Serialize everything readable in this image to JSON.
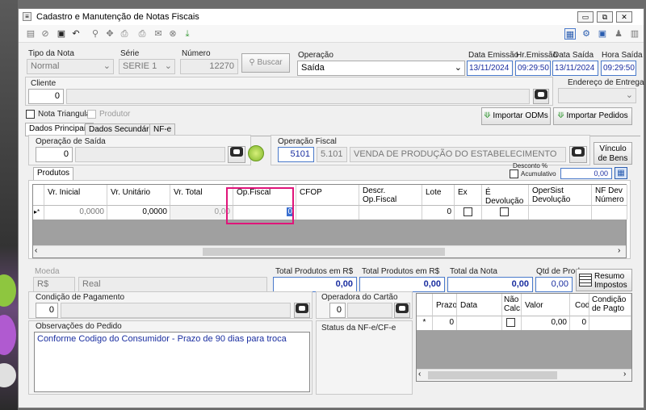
{
  "window": {
    "title": "Cadastro e Manutenção de Notas Fiscais",
    "controls": [
      "▭",
      "⧉",
      "✕"
    ]
  },
  "toolbar": {
    "left_icons": [
      "new-icon",
      "cancel-icon",
      "save-icon",
      "undo-icon",
      "search-icon",
      "tools-icon",
      "print-icon",
      "print2-icon",
      "email-icon",
      "block-icon",
      "download-icon"
    ],
    "right_icons": [
      "view-icon",
      "settings-icon",
      "window-icon",
      "user-icon",
      "config-icon"
    ]
  },
  "header": {
    "tipo_nota_label": "Tipo da Nota",
    "tipo_nota_value": "Normal",
    "serie_label": "Série",
    "serie_value": "SERIE 1",
    "numero_label": "Número",
    "numero_value": "12270",
    "buscar_label": "Buscar",
    "operacao_label": "Operação",
    "operacao_value": "Saída",
    "data_emissao_label": "Data Emissão",
    "data_emissao_value": "13/11/2024",
    "hr_emissao_label": "Hr.Emissão",
    "hr_emissao_value": "09:29:50",
    "data_saida_label": "Data Saída",
    "data_saida_value": "13/11/2024",
    "hora_saida_label": "Hora Saída",
    "hora_saida_value": "09:29:50"
  },
  "cliente": {
    "label": "Cliente",
    "code": "0",
    "endereco_label": "Endereço de Entrega"
  },
  "flags": {
    "nota_triangular": "Nota Triangular",
    "produtor": "Produtor"
  },
  "buttons": {
    "importar_odms": "Importar ODMs",
    "importar_pedidos": "Importar Pedidos",
    "vinculo_line1": "Vínculo",
    "vinculo_line2": "de Bens",
    "resumo_line1": "Resumo",
    "resumo_line2": "Impostos"
  },
  "tabs": [
    "Dados Principais",
    "Dados Secundários",
    "NF-e"
  ],
  "operacao_saida": {
    "label": "Operação de Saída",
    "code": "0"
  },
  "operacao_fiscal": {
    "label": "Operação Fiscal",
    "code": "5101",
    "cfop": "5.101",
    "description": "VENDA DE PRODUÇÃO DO ESTABELECIMENTO"
  },
  "produtos": {
    "tab_label": "Produtos",
    "desconto_label": "Desconto %",
    "acumulativo_label": "Acumulativo",
    "desconto_value": "0,00",
    "columns": [
      "Vr. Inicial",
      "Vr. Unitário",
      "Vr. Total",
      "Op.Fiscal",
      "CFOP",
      "Descr. Op.Fiscal",
      "Lote",
      "Ex",
      "É Devolução",
      "OperSist Devolução",
      "NF Dev Número"
    ],
    "row": {
      "indicator": "▸*",
      "vr_inicial": "0,0000",
      "vr_unitario": "0,0000",
      "vr_total": "0,00",
      "op_fiscal": "0",
      "lote": "0"
    }
  },
  "moeda": {
    "label": "Moeda",
    "code": "R$",
    "name": "Real"
  },
  "totais": {
    "produtos_rs_label": "Total Produtos em R$",
    "produtos_rs_value": "0,00",
    "produtos_rs2_label": "Total Produtos em R$",
    "produtos_rs2_value": "0,00",
    "nota_label": "Total da Nota",
    "nota_value": "0,00",
    "qtd_label": "Qtd de Prod.",
    "qtd_value": "0,00"
  },
  "pagamento": {
    "label": "Condição de Pagamento",
    "code": "0"
  },
  "operadora": {
    "label": "Operadora do Cartão",
    "code": "0"
  },
  "observacoes": {
    "label": "Observações do Pedido",
    "text": "Conforme Codigo do Consumidor - Prazo de 90 dias para troca"
  },
  "status": {
    "label": "Status da NF-e/CF-e"
  },
  "parcelas": {
    "columns": [
      "Prazo",
      "Data",
      "Não Calc.",
      "Valor",
      "Cod.",
      "Condição de Pagto"
    ],
    "row": {
      "indicator": "*",
      "prazo": "0",
      "valor": "0,00",
      "cod": "0"
    }
  },
  "colors": {
    "highlight": "#e0157a",
    "accent_blue": "#1a2ea0"
  }
}
